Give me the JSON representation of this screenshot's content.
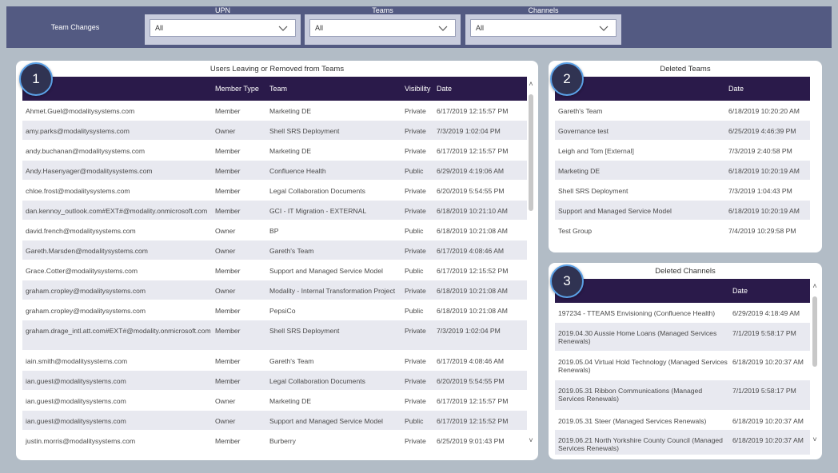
{
  "header": {
    "title": "Team Changes",
    "filters": [
      {
        "label": "UPN",
        "value": "All"
      },
      {
        "label": "Teams",
        "value": "All"
      },
      {
        "label": "Channels",
        "value": "All"
      }
    ]
  },
  "panel1": {
    "badge": "1",
    "title": "Users Leaving or Removed from Teams",
    "columns": [
      "",
      "Member Type",
      "Team",
      "Visibility",
      "Date"
    ],
    "rows": [
      [
        "Ahmet.Guel@modalitysystems.com",
        "Member",
        "Marketing DE",
        "Private",
        "6/17/2019 12:15:57 PM"
      ],
      [
        "amy.parks@modalitysystems.com",
        "Owner",
        "Shell SRS Deployment",
        "Private",
        "7/3/2019 1:02:04 PM"
      ],
      [
        "andy.buchanan@modalitysystems.com",
        "Member",
        "Marketing DE",
        "Private",
        "6/17/2019 12:15:57 PM"
      ],
      [
        "Andy.Hasenyager@modalitysystems.com",
        "Member",
        "Confluence Health",
        "Public",
        "6/29/2019 4:19:06 AM"
      ],
      [
        "chloe.frost@modalitysystems.com",
        "Member",
        "Legal Collaboration Documents",
        "Private",
        "6/20/2019 5:54:55 PM"
      ],
      [
        "dan.kennoy_outlook.com#EXT#@modality.onmicrosoft.com",
        "Member",
        "GCI - IT Migration - EXTERNAL",
        "Private",
        "6/18/2019 10:21:10 AM"
      ],
      [
        "david.french@modalitysystems.com",
        "Owner",
        "BP",
        "Public",
        "6/18/2019 10:21:08 AM"
      ],
      [
        "Gareth.Marsden@modalitysystems.com",
        "Owner",
        "Gareth's Team",
        "Private",
        "6/17/2019 4:08:46 AM"
      ],
      [
        "Grace.Cotter@modalitysystems.com",
        "Member",
        "Support and Managed Service Model",
        "Public",
        "6/17/2019 12:15:52 PM"
      ],
      [
        "graham.cropley@modalitysystems.com",
        "Owner",
        "Modality - Internal Transformation Project",
        "Private",
        "6/18/2019 10:21:08 AM"
      ],
      [
        "graham.cropley@modalitysystems.com",
        "Member",
        "PepsiCo",
        "Public",
        "6/18/2019 10:21:08 AM"
      ],
      [
        "graham.drage_intl.att.com#EXT#@modality.onmicrosoft.com",
        "Member",
        "Shell SRS Deployment",
        "Private",
        "7/3/2019 1:02:04 PM"
      ],
      [
        "iain.smith@modalitysystems.com",
        "Member",
        "Gareth's Team",
        "Private",
        "6/17/2019 4:08:46 AM"
      ],
      [
        "ian.guest@modalitysystems.com",
        "Member",
        "Legal Collaboration Documents",
        "Private",
        "6/20/2019 5:54:55 PM"
      ],
      [
        "ian.guest@modalitysystems.com",
        "Owner",
        "Marketing DE",
        "Private",
        "6/17/2019 12:15:57 PM"
      ],
      [
        "ian.guest@modalitysystems.com",
        "Owner",
        "Support and Managed Service Model",
        "Public",
        "6/17/2019 12:15:52 PM"
      ],
      [
        "justin.morris@modalitysystems.com",
        "Member",
        "Burberry",
        "Private",
        "6/25/2019 9:01:43 PM"
      ]
    ]
  },
  "panel2": {
    "badge": "2",
    "title": "Deleted Teams",
    "columns": [
      "",
      "Date"
    ],
    "rows": [
      [
        "Gareth's Team",
        "6/18/2019 10:20:20 AM"
      ],
      [
        "Governance test",
        "6/25/2019 4:46:39 PM"
      ],
      [
        "Leigh and Tom [External]",
        "7/3/2019 2:40:58 PM"
      ],
      [
        "Marketing DE",
        "6/18/2019 10:20:19 AM"
      ],
      [
        "Shell SRS Deployment",
        "7/3/2019 1:04:43 PM"
      ],
      [
        "Support and Managed Service Model",
        "6/18/2019 10:20:19 AM"
      ],
      [
        "Test Group",
        "7/4/2019 10:29:58 PM"
      ]
    ]
  },
  "panel3": {
    "badge": "3",
    "title": "Deleted Channels",
    "columns": [
      "",
      "Date"
    ],
    "rows": [
      [
        "197234 - TTEAMS Envisioning (Confluence Health)",
        "6/29/2019 4:18:49 AM"
      ],
      [
        "2019.04.30 Aussie Home Loans (Managed Services Renewals)",
        "7/1/2019 5:58:17 PM"
      ],
      [
        "2019.05.04 Virtual Hold Technology (Managed Services Renewals)",
        "6/18/2019 10:20:37 AM"
      ],
      [
        "2019.05.31 Ribbon Communications (Managed Services Renewals)",
        "7/1/2019 5:58:17 PM"
      ],
      [
        "2019.05.31 Steer (Managed Services Renewals)",
        "6/18/2019 10:20:37 AM"
      ],
      [
        "2019.06.21 North Yorkshire County Council (Managed Services Renewals)",
        "6/18/2019 10:20:37 AM"
      ]
    ]
  },
  "colors": {
    "topbar": "#535a82",
    "header_row": "#2a1a4a",
    "background": "#b2bcc6",
    "badge_border": "#5ba0e6"
  },
  "icons": [
    "chevron-down-icon",
    "scroll-up-icon",
    "scroll-down-icon"
  ]
}
